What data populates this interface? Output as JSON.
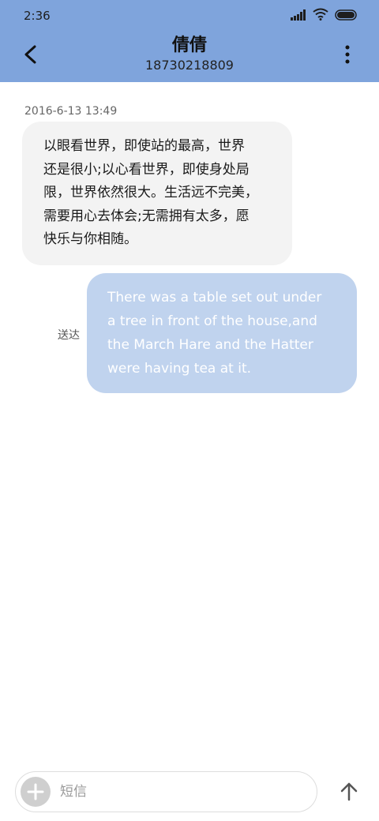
{
  "status_bar": {
    "time": "2:36",
    "icons": [
      "signal-icon",
      "wifi-icon",
      "battery-icon"
    ]
  },
  "header": {
    "contact_name": "倩倩",
    "contact_number": "18730218809",
    "background_color": "#7fa4dc",
    "back_icon": "chevron-left-icon",
    "more_icon": "more-vertical-icon"
  },
  "conversation": {
    "timestamp": "2016-6-13 13:49",
    "incoming": {
      "text": "以眼看世界，即使站的最高，世界\n还是很小;以心看世界，即使身处局\n限，世界依然很大。生活远不完美，\n需要用心去体会;无需拥有太多，愿\n快乐与你相随。"
    },
    "outgoing": {
      "text": "There was a table set out under\na tree in front of the house,and\nthe March Hare and the Hatter\nwere having tea at it.",
      "status": "送达",
      "bubble_color": "#c0d3ee"
    }
  },
  "composer": {
    "placeholder": "短信",
    "add_icon": "plus-icon",
    "send_icon": "arrow-up-icon"
  }
}
